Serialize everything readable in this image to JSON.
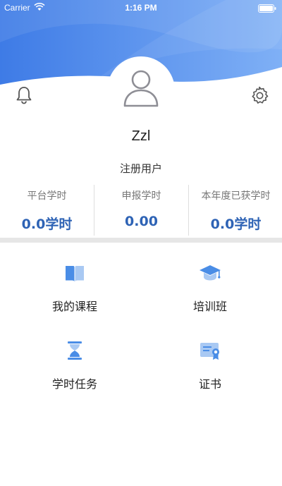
{
  "status_bar": {
    "carrier": "Carrier",
    "time": "1:16 PM"
  },
  "profile": {
    "username": "Zzl",
    "role": "注册用户"
  },
  "stats": [
    {
      "label": "平台学时",
      "value": "0.0学时"
    },
    {
      "label": "申报学时",
      "value": "0.00"
    },
    {
      "label": "本年度已获学时",
      "value": "0.0学时"
    }
  ],
  "menu": [
    {
      "label": "我的课程",
      "icon": "book-icon"
    },
    {
      "label": "培训班",
      "icon": "graduation-cap-icon"
    },
    {
      "label": "学时任务",
      "icon": "hourglass-icon"
    },
    {
      "label": "证书",
      "icon": "certificate-icon"
    }
  ],
  "colors": {
    "header_gradient_start": "#3a78e8",
    "header_gradient_end": "#8ab8f8",
    "accent": "#2e63b5",
    "icon_blue": "#4a8de6"
  }
}
